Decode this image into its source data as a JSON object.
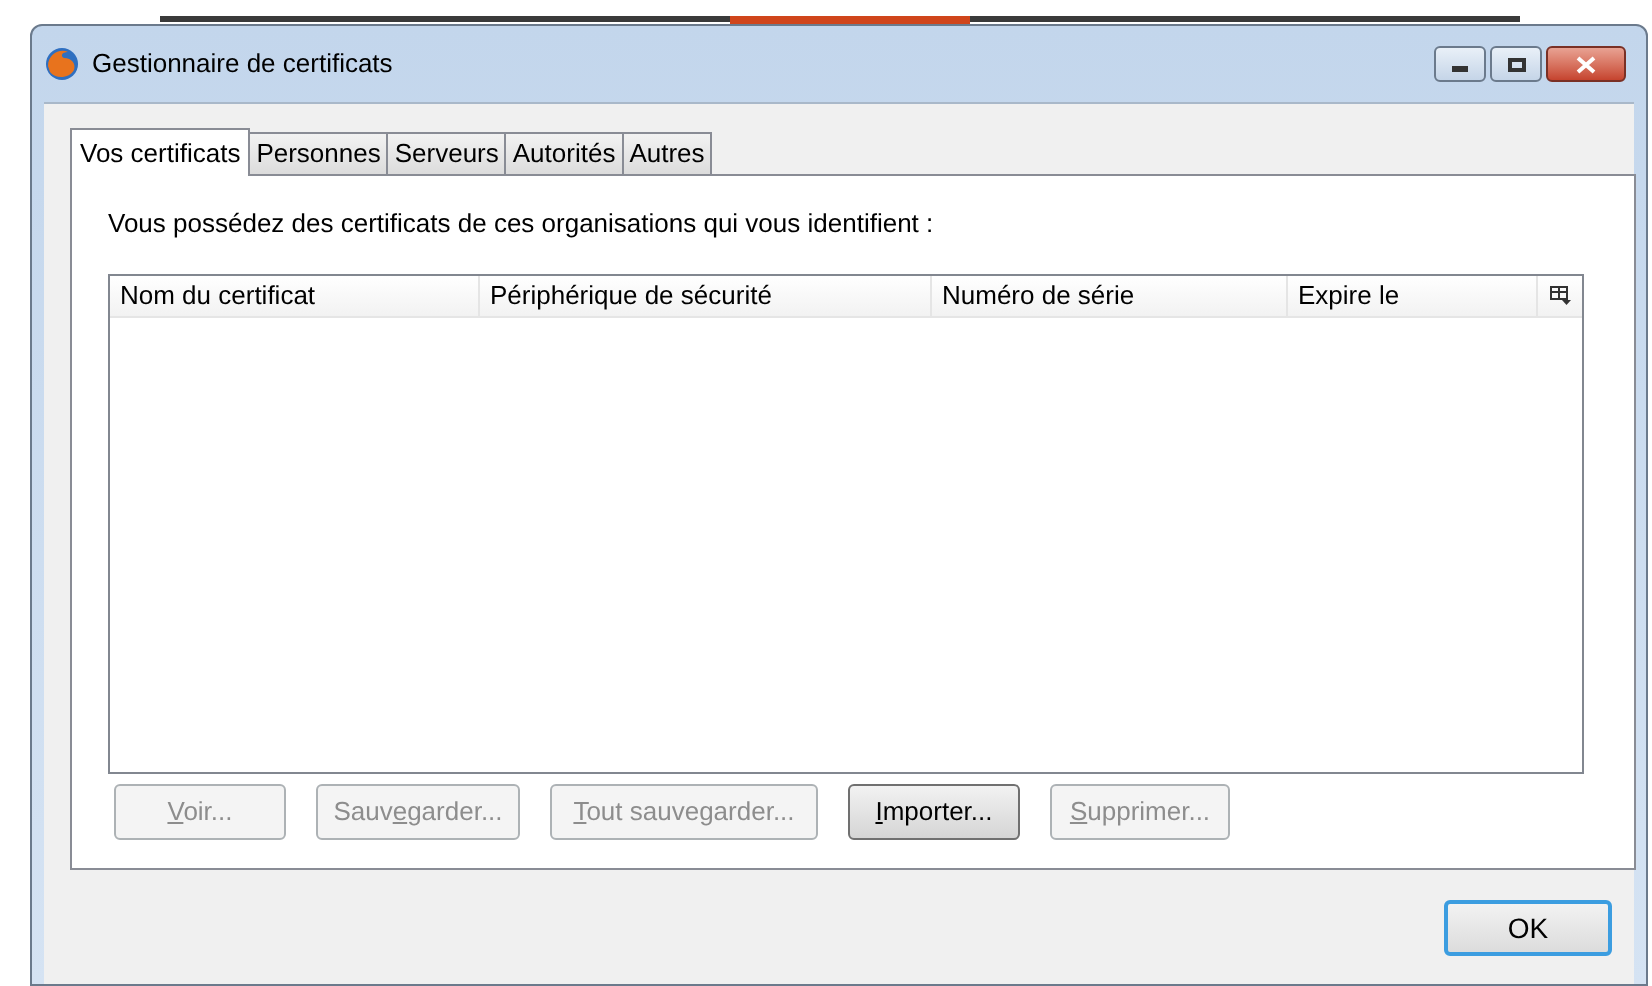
{
  "window": {
    "title": "Gestionnaire de certificats"
  },
  "tabs": [
    {
      "label": "Vos certificats",
      "selected": true
    },
    {
      "label": "Personnes",
      "selected": false
    },
    {
      "label": "Serveurs",
      "selected": false
    },
    {
      "label": "Autorités",
      "selected": false
    },
    {
      "label": "Autres",
      "selected": false
    }
  ],
  "description": "Vous possédez des certificats de ces organisations qui vous identifient :",
  "table": {
    "columns": [
      "Nom du certificat",
      "Périphérique de sécurité",
      "Numéro de série",
      "Expire le"
    ]
  },
  "buttons": [
    {
      "access_key": "V",
      "after": "oir...",
      "disabled": true
    },
    {
      "before": "Sauv",
      "access_key": "e",
      "after": "garder...",
      "disabled": true
    },
    {
      "access_key": "T",
      "after": "out sauvegarder...",
      "disabled": true
    },
    {
      "access_key": "I",
      "after": "mporter...",
      "disabled": false
    },
    {
      "access_key": "S",
      "after": "upprimer...",
      "disabled": true
    }
  ],
  "ok_button": "OK"
}
